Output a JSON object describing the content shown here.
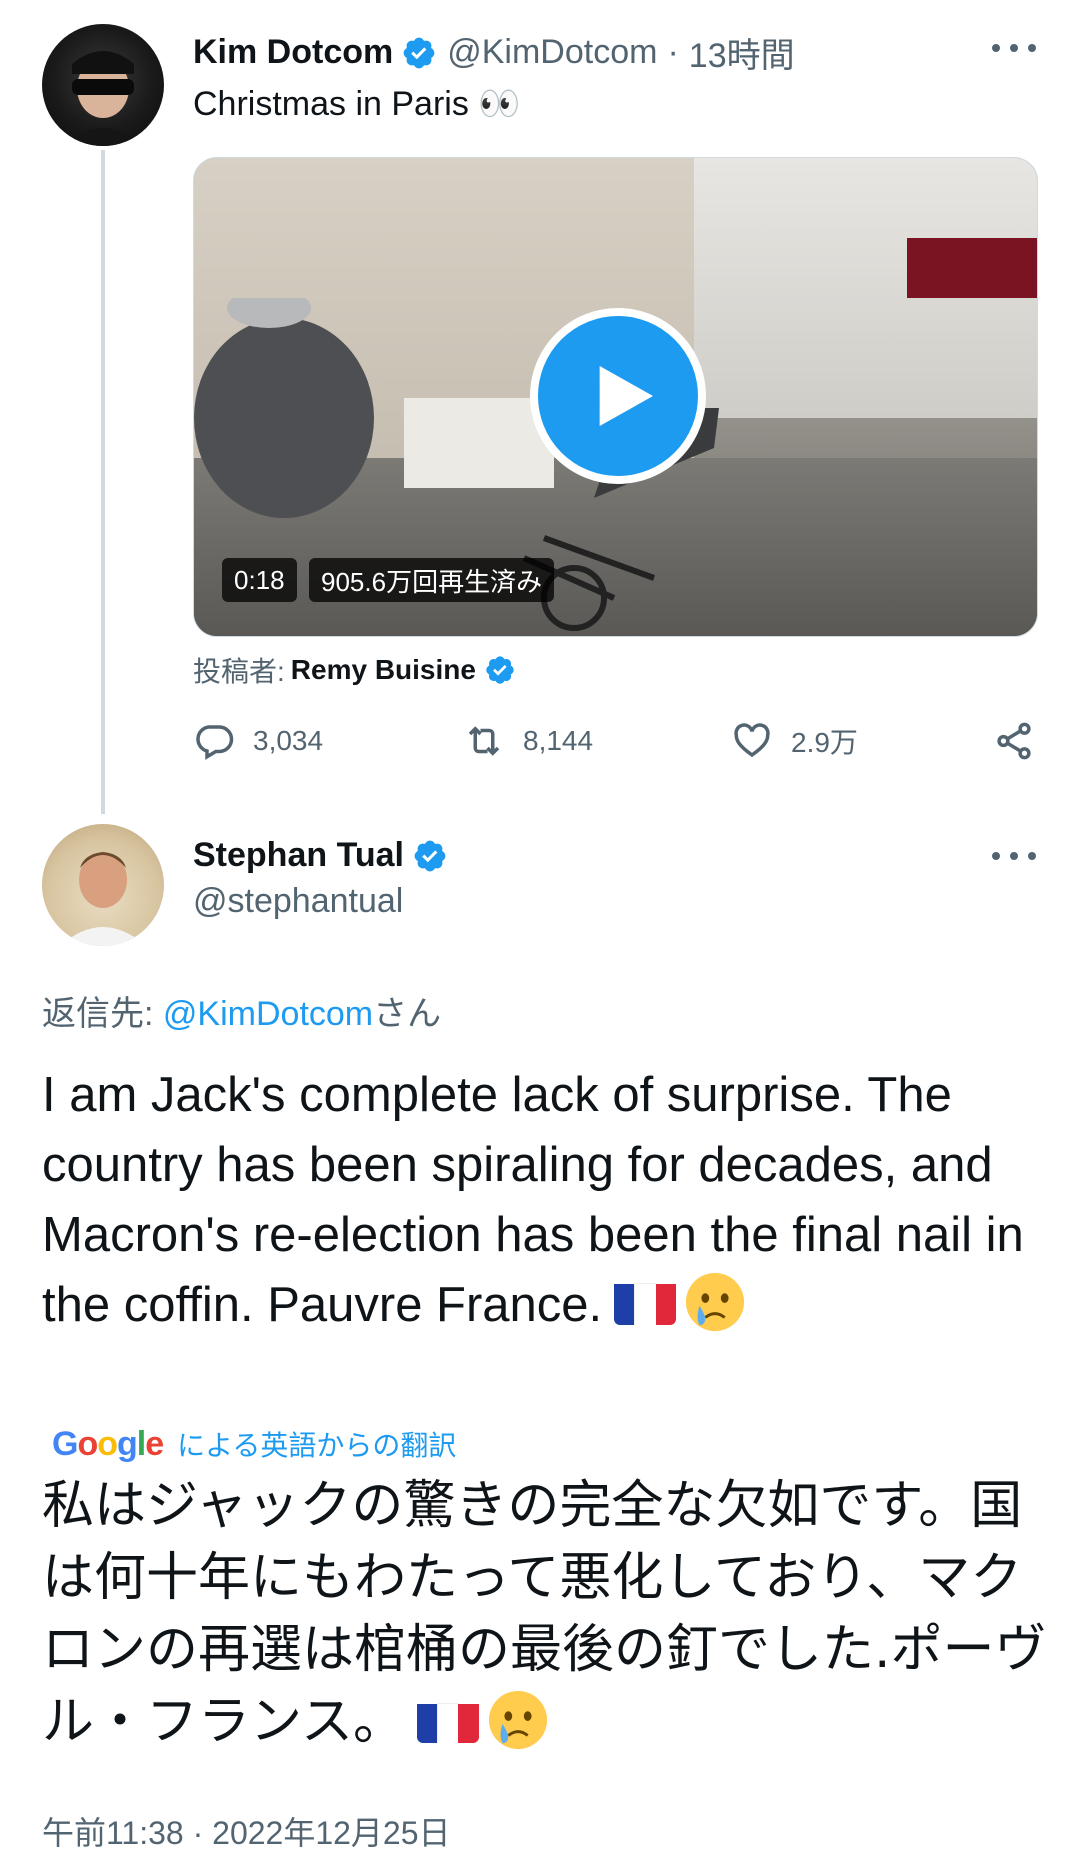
{
  "original_tweet": {
    "display_name": "Kim Dotcom",
    "handle": "@KimDotcom",
    "separator": "·",
    "time_ago": "13時間",
    "text": "Christmas in Paris 👀",
    "media": {
      "duration": "0:18",
      "views": "905.6万回再生済み",
      "play_icon": "play-icon"
    },
    "posted_by_label": "投稿者:",
    "posted_by_name": "Remy Buisine",
    "actions": {
      "replies": "3,034",
      "retweets": "8,144",
      "likes": "2.9万"
    }
  },
  "reply_tweet": {
    "display_name": "Stephan Tual",
    "handle": "@stephantual",
    "reply_to_label": "返信先: ",
    "reply_to_mention": "@KimDotcom",
    "reply_to_suffix": "さん",
    "text": "I am Jack's complete lack of surprise. The country has been spiraling for decades, and Macron's re-election has been the final nail in the coffin. Pauvre France.",
    "translation_label": "による英語からの翻訳",
    "translation_text": "私はジャックの驚きの完全な欠如です。国は何十年にもわたって悪化しており、マクロンの再選は棺桶の最後の釘でした.ポーヴル・フランス。",
    "timestamp": "午前11:38 · 2022年12月25日"
  },
  "colors": {
    "accent": "#1d9bf0",
    "secondary_text": "#536471",
    "primary_text": "#0f1419",
    "thread_line": "#cfd9de"
  }
}
